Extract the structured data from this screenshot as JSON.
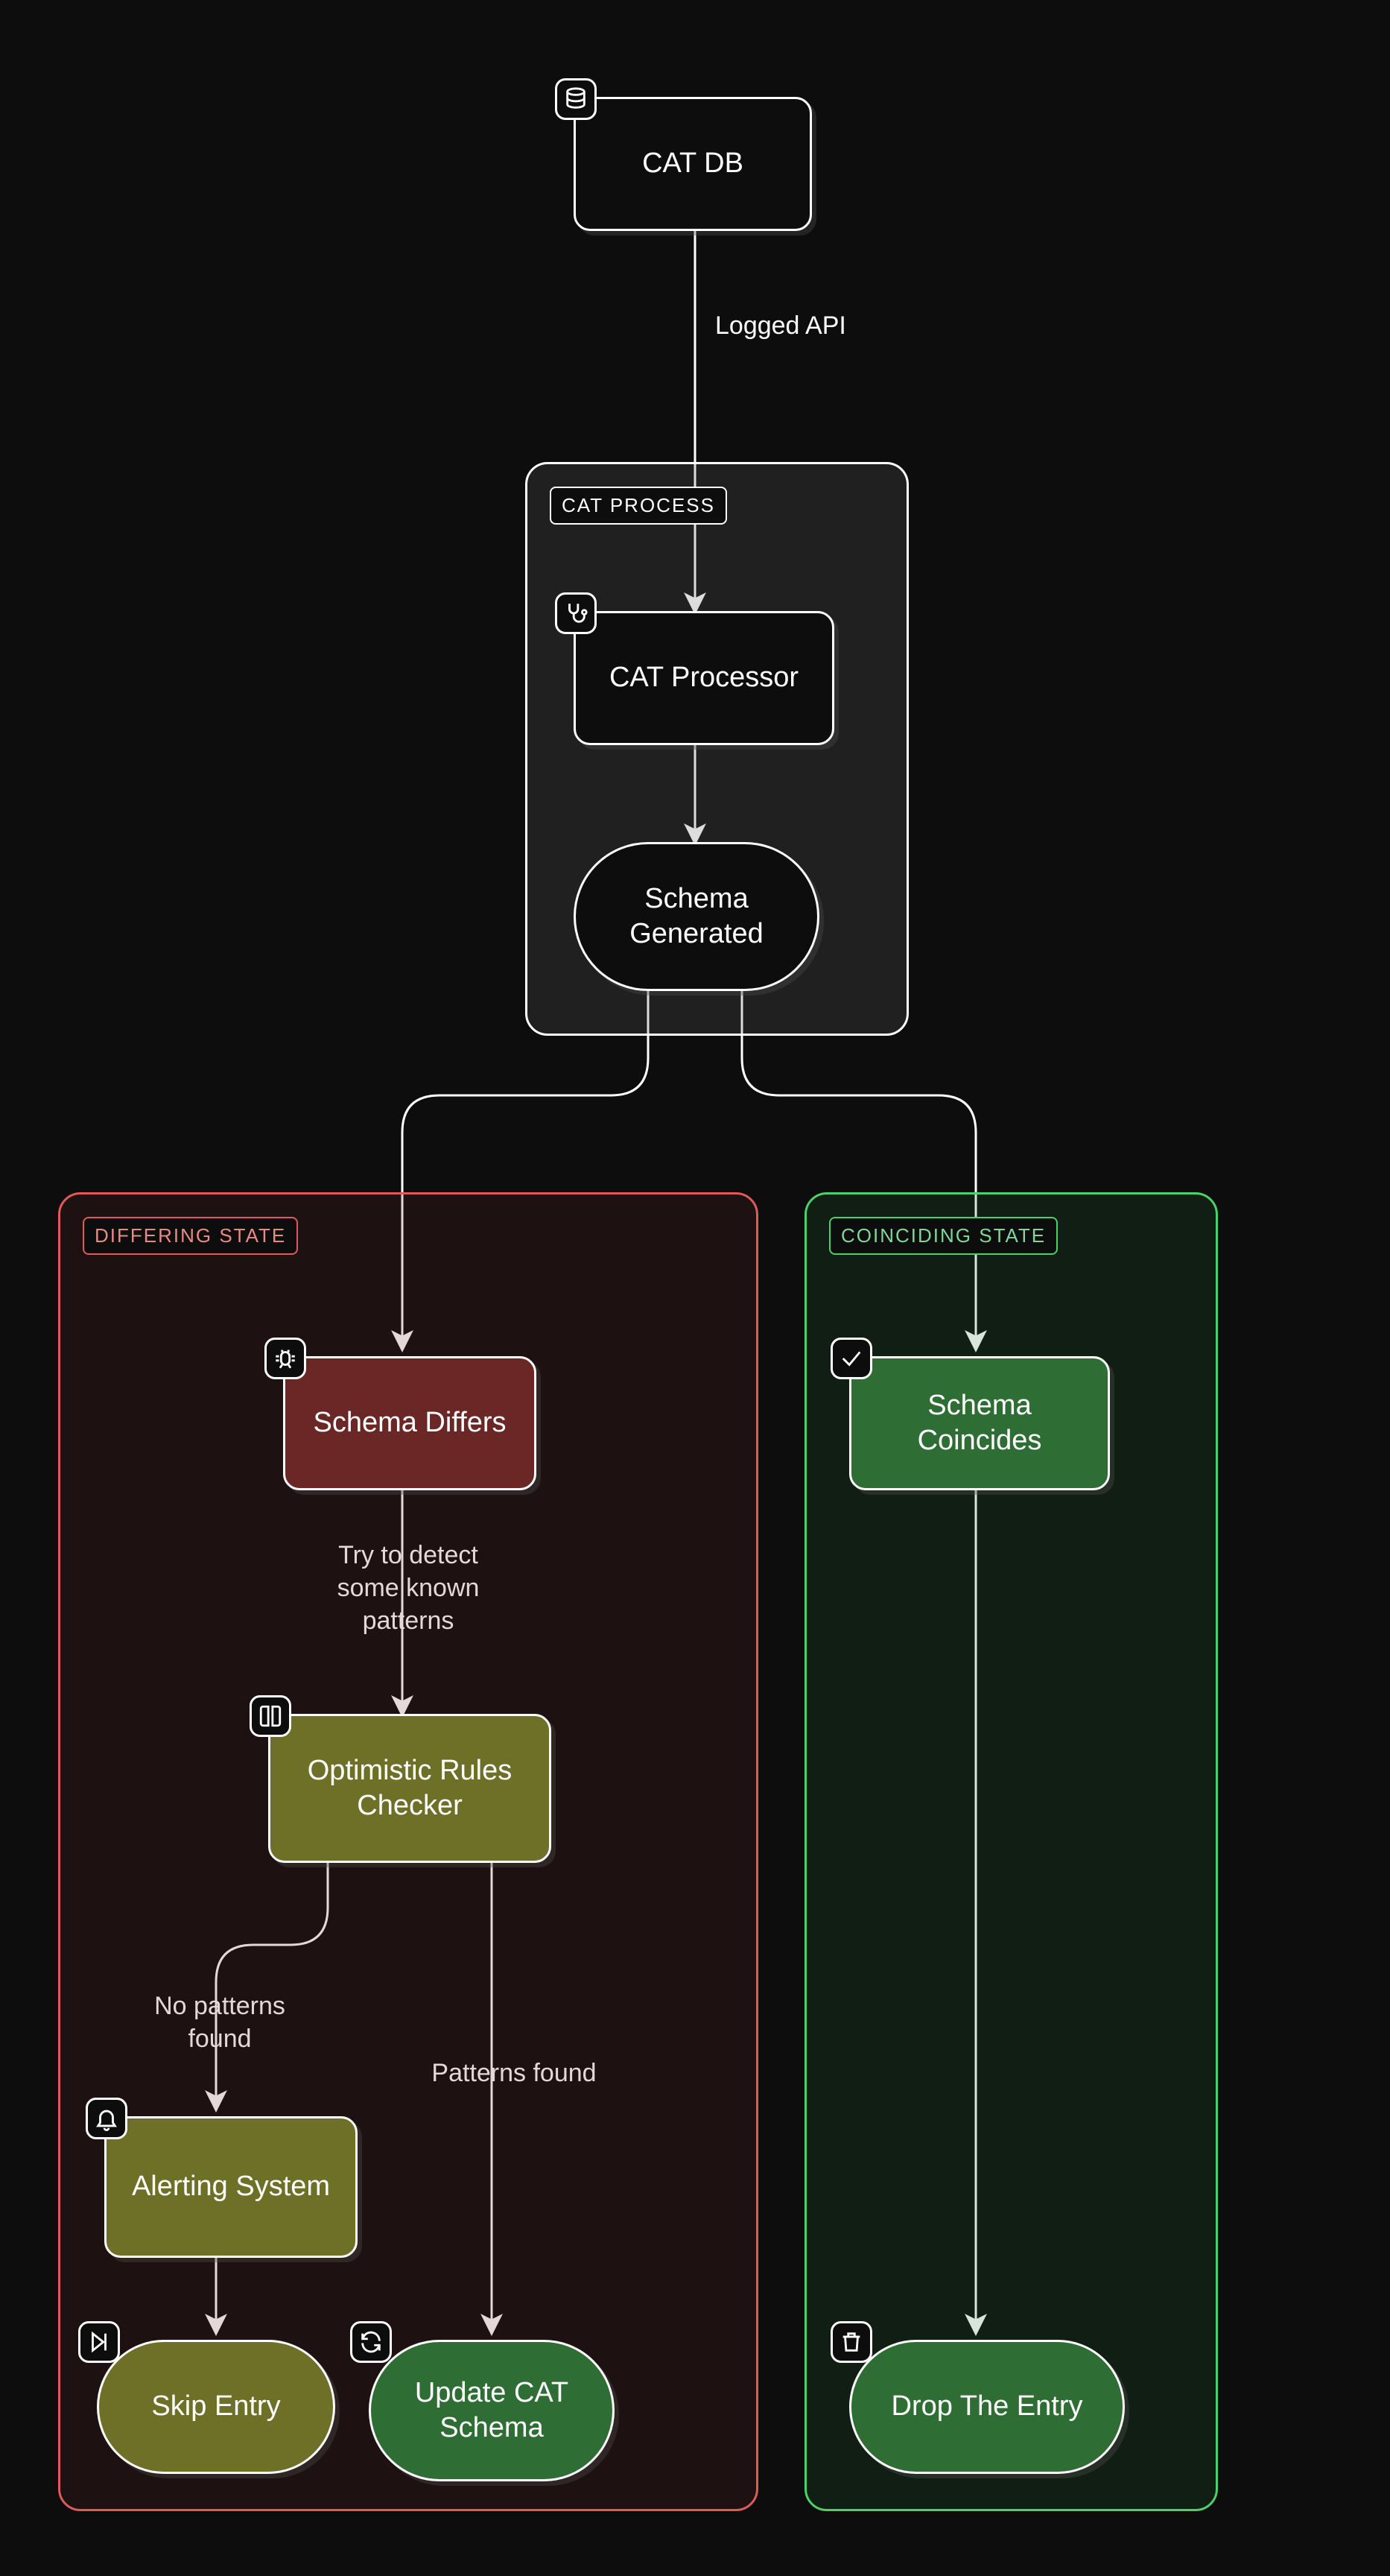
{
  "nodes": {
    "cat_db": {
      "label": "CAT DB",
      "icon": "database"
    },
    "cat_processor": {
      "label": "CAT Processor",
      "icon": "stethoscope"
    },
    "schema_generated": {
      "label": "Schema Generated",
      "icon": null
    },
    "schema_differs": {
      "label": "Schema Differs",
      "icon": "bug"
    },
    "optimistic_rules": {
      "label": "Optimistic Rules Checker",
      "icon": "book"
    },
    "alerting_system": {
      "label": "Alerting System",
      "icon": "bell"
    },
    "skip_entry": {
      "label": "Skip Entry",
      "icon": "skip"
    },
    "update_cat_schema": {
      "label": "Update CAT Schema",
      "icon": "refresh"
    },
    "schema_coincides": {
      "label": "Schema Coincides",
      "icon": "check"
    },
    "drop_entry": {
      "label": "Drop The Entry",
      "icon": "trash"
    }
  },
  "groups": {
    "cat_process": {
      "title": "CAT PROCESS"
    },
    "differing": {
      "title": "DIFFERING STATE"
    },
    "coinciding": {
      "title": "COINCIDING STATE"
    }
  },
  "edges": {
    "logged_api": {
      "label": "Logged API"
    },
    "detect_patterns": {
      "label": "Try to detect some known patterns"
    },
    "no_patterns": {
      "label": "No patterns found"
    },
    "patterns_found": {
      "label": "Patterns found"
    }
  },
  "colors": {
    "bg": "#0d0d0d",
    "node_border": "#ffffff",
    "group_gray": "rgba(100,100,100,0.22)",
    "darkred": "#6b2626",
    "olive": "#6e7027",
    "green": "#2e6e34",
    "group_red_border": "#e05a5a",
    "group_green_border": "#4bd06a"
  }
}
